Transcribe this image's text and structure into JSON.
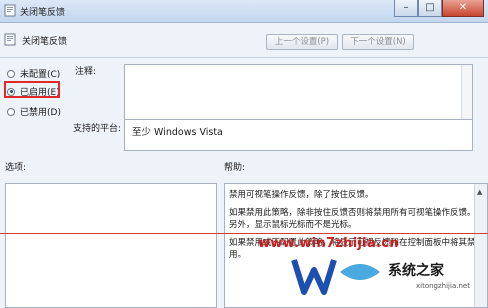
{
  "window": {
    "title": "关闭笔反馈",
    "buttons": {
      "minimize": "–",
      "maximize": "□",
      "close": "✕"
    }
  },
  "policy": {
    "name": "关闭笔反馈",
    "prev_setting": "上一个设置(P)",
    "next_setting": "下一个设置(N)"
  },
  "state": {
    "options": [
      {
        "label": "未配置(C)",
        "selected": false
      },
      {
        "label": "已启用(E)",
        "selected": true
      },
      {
        "label": "已禁用(D)",
        "selected": false
      }
    ]
  },
  "comment": {
    "label": "注释:",
    "value": ""
  },
  "supported": {
    "label": "支持的平台:",
    "value": "至少 Windows Vista"
  },
  "sections": {
    "options_label": "选项:",
    "help_label": "帮助:"
  },
  "help": {
    "p1": "禁用可视笔操作反馈，除了按住反馈。",
    "p2": "如果禁用此策略，除非按住反馈否则将禁用所有可视笔操作反馈。另外，显示鼠标光标而不是光标。",
    "p3a": "如果禁用或不配置此策略，将显示可视反馈和",
    "p3b": "在控制面板中将其禁用。"
  },
  "watermark": {
    "url": "www.win7zhijia.cn",
    "brand": "系统之家",
    "small": "xitongzhijia.net"
  }
}
